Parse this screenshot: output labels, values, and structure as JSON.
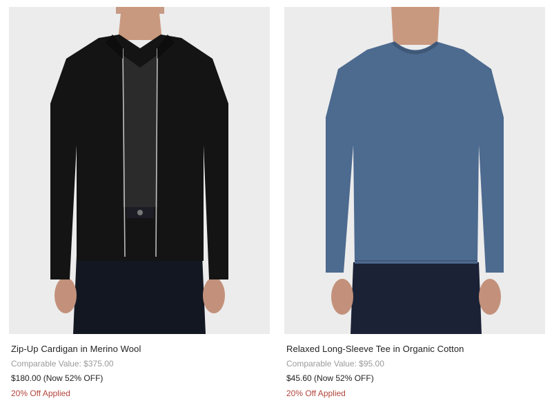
{
  "products": [
    {
      "title": "Zip-Up Cardigan in Merino Wool",
      "comparable_label": "Comparable Value: $375.00",
      "price_label": "$180.00 (Now 52% OFF)",
      "promo_label": "20% Off Applied",
      "garment_color": "#141414"
    },
    {
      "title": "Relaxed Long-Sleeve Tee in Organic Cotton",
      "comparable_label": "Comparable Value: $95.00",
      "price_label": "$45.60 (Now 52% OFF)",
      "promo_label": "20% Off Applied",
      "garment_color": "#4d6a8f"
    }
  ],
  "colors": {
    "image_bg": "#ececec",
    "promo_text": "#b2453c",
    "muted_text": "#9a9a9a"
  }
}
